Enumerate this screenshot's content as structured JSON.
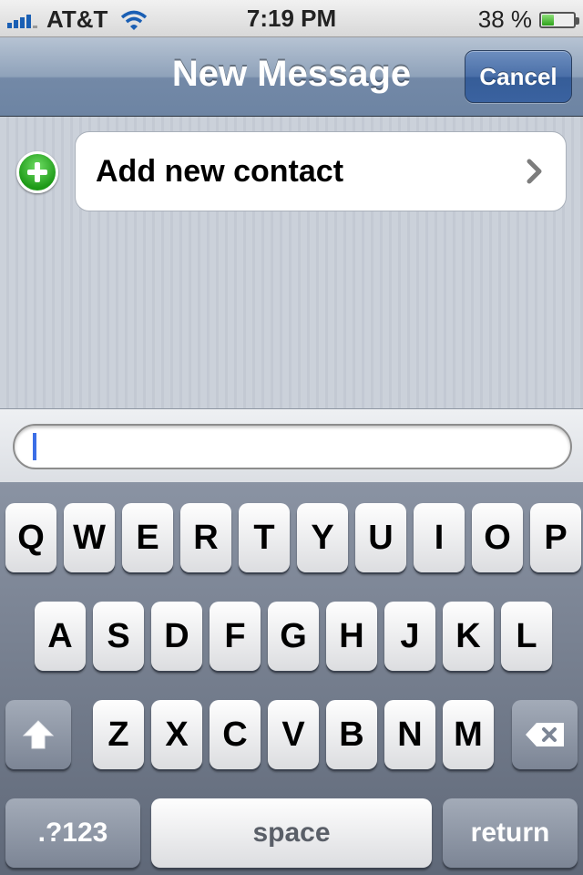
{
  "status_bar": {
    "carrier": "AT&T",
    "time": "7:19 PM",
    "battery_percent": "38 %",
    "battery_level": 0.38,
    "signal_bars": 4
  },
  "nav": {
    "title": "New Message",
    "cancel_label": "Cancel"
  },
  "recipient": {
    "add_contact_label": "Add new contact"
  },
  "message_field": {
    "value": ""
  },
  "keyboard": {
    "row1": [
      "Q",
      "W",
      "E",
      "R",
      "T",
      "Y",
      "U",
      "I",
      "O",
      "P"
    ],
    "row2": [
      "A",
      "S",
      "D",
      "F",
      "G",
      "H",
      "J",
      "K",
      "L"
    ],
    "row3": [
      "Z",
      "X",
      "C",
      "V",
      "B",
      "N",
      "M"
    ],
    "numbers_label": ".?123",
    "space_label": "space",
    "return_label": "return"
  },
  "icons": [
    "signal-icon",
    "wifi-icon",
    "battery-icon",
    "add-icon",
    "chevron-right-icon",
    "shift-icon",
    "delete-icon"
  ]
}
